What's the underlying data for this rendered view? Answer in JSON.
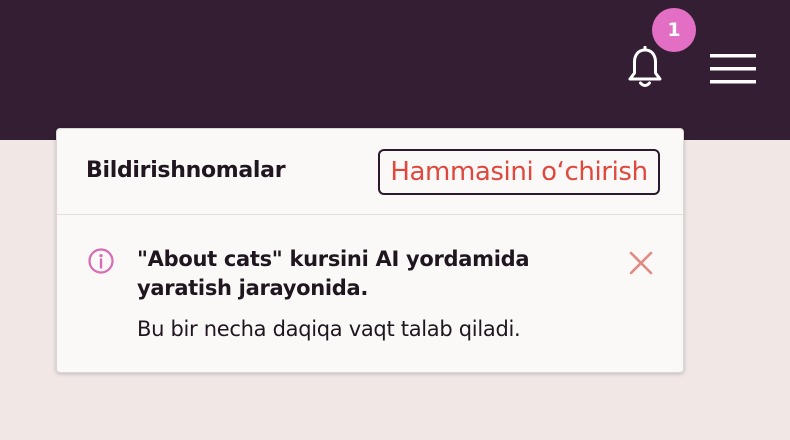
{
  "header": {
    "notifications_count": "1",
    "bell_icon": "bell-icon",
    "menu_icon": "hamburger-menu-icon"
  },
  "notifications_panel": {
    "title": "Bildirishnomalar",
    "clear_all_label": "Hammasini o‘chirish",
    "items": [
      {
        "icon": "info-icon",
        "title": "\"About cats\" kursini AI yordamida yaratish jarayonida.",
        "body": "Bu bir necha daqiqa vaqt talab qiladi.",
        "dismiss_icon": "close-icon"
      }
    ]
  },
  "colors": {
    "topbar": "#331e33",
    "page_background": "#f1e8e6",
    "badge": "#e26fc4",
    "clear_all_text": "#e0483e",
    "info_icon": "#d86bb5",
    "close_icon": "#e08b84"
  }
}
